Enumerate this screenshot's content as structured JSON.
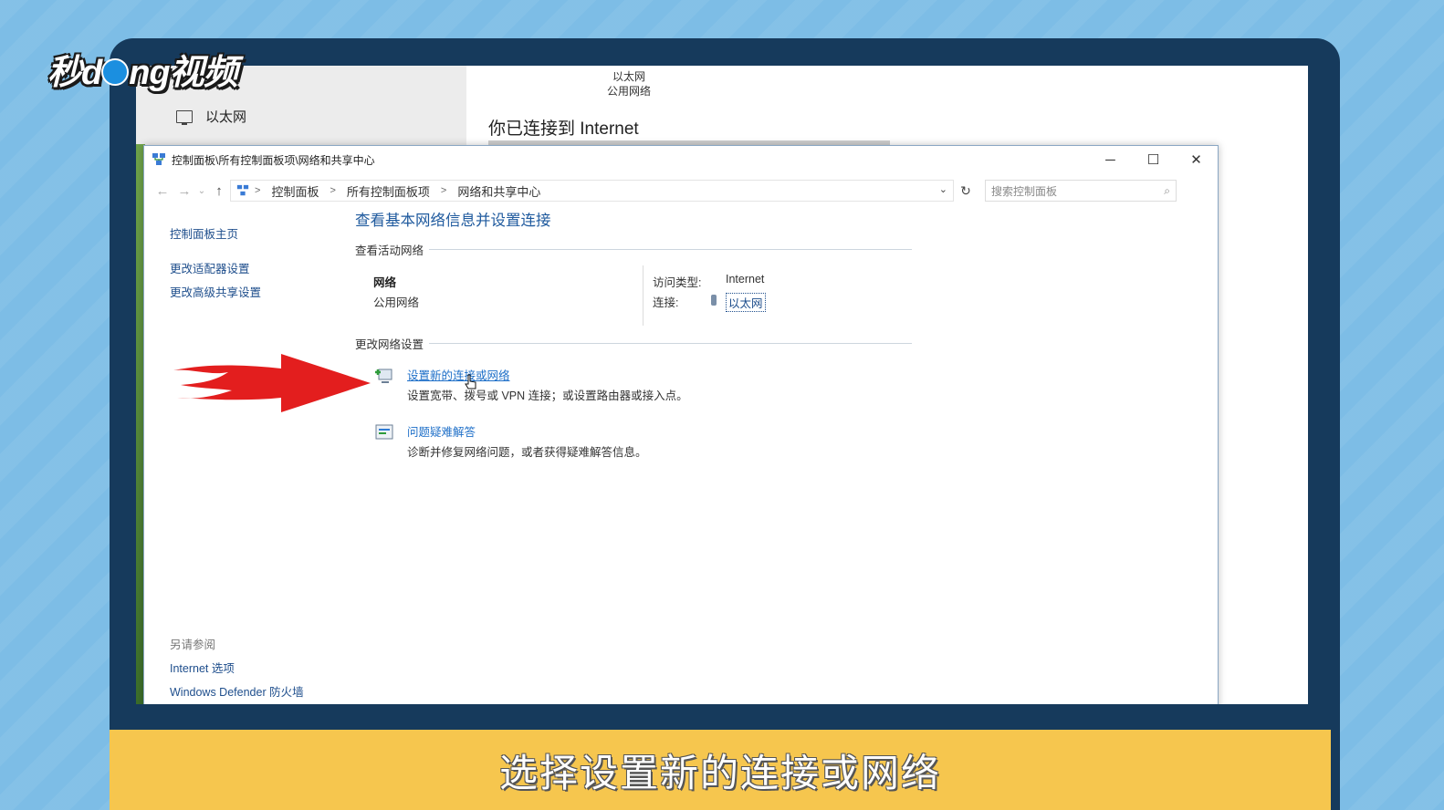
{
  "logo": {
    "text_before": "秒d",
    "text_after": "ng视频"
  },
  "background_window": {
    "ethernet_label": "以太网",
    "network_name": "以太网",
    "network_category": "公用网络",
    "connected_text": "你已连接到 Internet"
  },
  "window": {
    "title": "控制面板\\所有控制面板项\\网络和共享中心",
    "controls": {
      "minimize": "─",
      "maximize": "☐",
      "close": "✕"
    },
    "breadcrumb": [
      "控制面板",
      "所有控制面板项",
      "网络和共享中心"
    ],
    "search_placeholder": "搜索控制面板"
  },
  "left_pane": {
    "items": [
      "控制面板主页",
      "更改适配器设置",
      "更改高级共享设置"
    ],
    "see_also_heading": "另请参阅",
    "see_also": [
      "Internet 选项",
      "Windows Defender 防火墙"
    ]
  },
  "main": {
    "title": "查看基本网络信息并设置连接",
    "active_section": "查看活动网络",
    "network": {
      "name": "网络",
      "category": "公用网络",
      "access_type_label": "访问类型:",
      "access_type_value": "Internet",
      "connection_label": "连接:",
      "connection_value": "以太网"
    },
    "change_section": "更改网络设置",
    "tasks": [
      {
        "link": "设置新的连接或网络",
        "desc": "设置宽带、拨号或 VPN 连接；或设置路由器或接入点。"
      },
      {
        "link": "问题疑难解答",
        "desc": "诊断并修复网络问题，或者获得疑难解答信息。"
      }
    ]
  },
  "caption": "选择设置新的连接或网络",
  "colors": {
    "frame": "#163a5c",
    "caption_bar": "#f6c64e",
    "link": "#1e4e8c",
    "arrow": "#e31e1e"
  }
}
